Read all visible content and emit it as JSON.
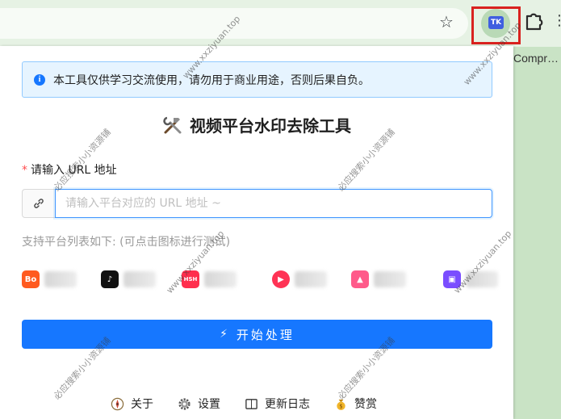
{
  "browser": {
    "star_glyph": "☆",
    "more_glyph": "⋮",
    "ext_logo_text": "TK",
    "background_page_text": "Compr…",
    "extension_highlight_color": "#d9221f"
  },
  "popup": {
    "notice": {
      "icon": "info-icon",
      "text": "本工具仅供学习交流使用，请勿用于商业用途，否则后果自负。"
    },
    "title": "视频平台水印去除工具",
    "url_field": {
      "required_mark": "*",
      "label": "请输入 URL 地址",
      "placeholder": "请输入平台对应的 URL 地址 ~",
      "value": ""
    },
    "platform_hint": "支持平台列表如下: (可点击图标进行测试)",
    "platforms": [
      {
        "icon_text": "Bo",
        "color": "#ff5a1f",
        "name": ""
      },
      {
        "icon_text": "♪",
        "color": "#111111",
        "name": ""
      },
      {
        "icon_text": "HSH",
        "color": "#ff2e4d",
        "name": ""
      },
      {
        "icon_text": "▶",
        "color": "#ff3355",
        "name": ""
      },
      {
        "icon_text": "▲",
        "color": "#ff5a8a",
        "name": ""
      },
      {
        "icon_text": "▣",
        "color": "#7a4dff",
        "name": ""
      }
    ],
    "start_button": {
      "icon": "lightning-icon",
      "label": "开始处理",
      "color": "#1677ff"
    },
    "footer": [
      {
        "icon": "compass-icon",
        "label": "关于"
      },
      {
        "icon": "gear-icon",
        "label": "设置"
      },
      {
        "icon": "log-icon",
        "label": "更新日志"
      },
      {
        "icon": "money-bag-icon",
        "label": "赞赏"
      }
    ]
  },
  "watermarks": {
    "site": "www.xxziyuan.top",
    "shop": "必应搜索小小资源铺"
  }
}
